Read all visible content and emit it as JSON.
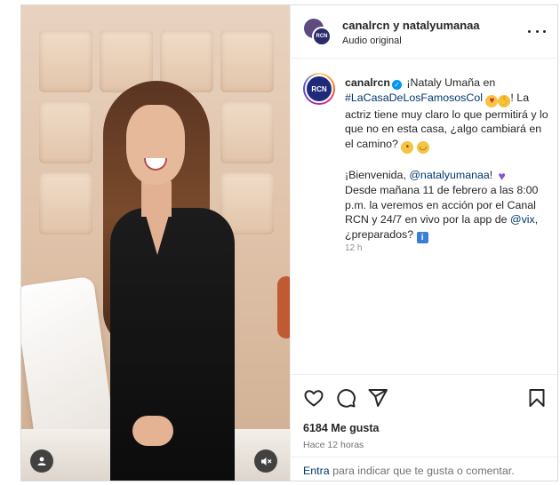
{
  "header": {
    "username": "canalrcn y natalyumanaa",
    "subtitle": "Audio original"
  },
  "caption": {
    "username": "canalrcn",
    "p1_part1": "¡Nataly Umaña en",
    "hashtag": "#LaCasaDeLosFamososCol",
    "p1_part2": "! La actriz tiene muy claro lo que permitirá y lo que no en esta casa, ¿algo cambiará en el camino?",
    "p2_part1": "¡Bienvenida,",
    "mention1": "@natalyumanaa",
    "p2_part2": "!",
    "p3_part1": "Desde mañana 11 de febrero a las 8:00 p.m. la veremos en acción por el Canal RCN y 24/7 en vivo por la app de",
    "mention2": "@vix",
    "p3_part2": ", ¿preparados?",
    "time": "12 h"
  },
  "actions": {
    "likes": "6184 Me gusta",
    "ago": "Hace 12 horas"
  },
  "comment_bar": {
    "link": "Entra",
    "text": " para indicar que te gusta o comentar."
  },
  "icons": {
    "like": "heart-icon",
    "comment": "comment-icon",
    "share": "share-icon",
    "save": "bookmark-icon",
    "more": "more-icon",
    "mute": "mute-icon",
    "user": "user-icon"
  },
  "colors": {
    "link": "#00376b",
    "verified": "#0095f6",
    "muted": "#737373"
  }
}
